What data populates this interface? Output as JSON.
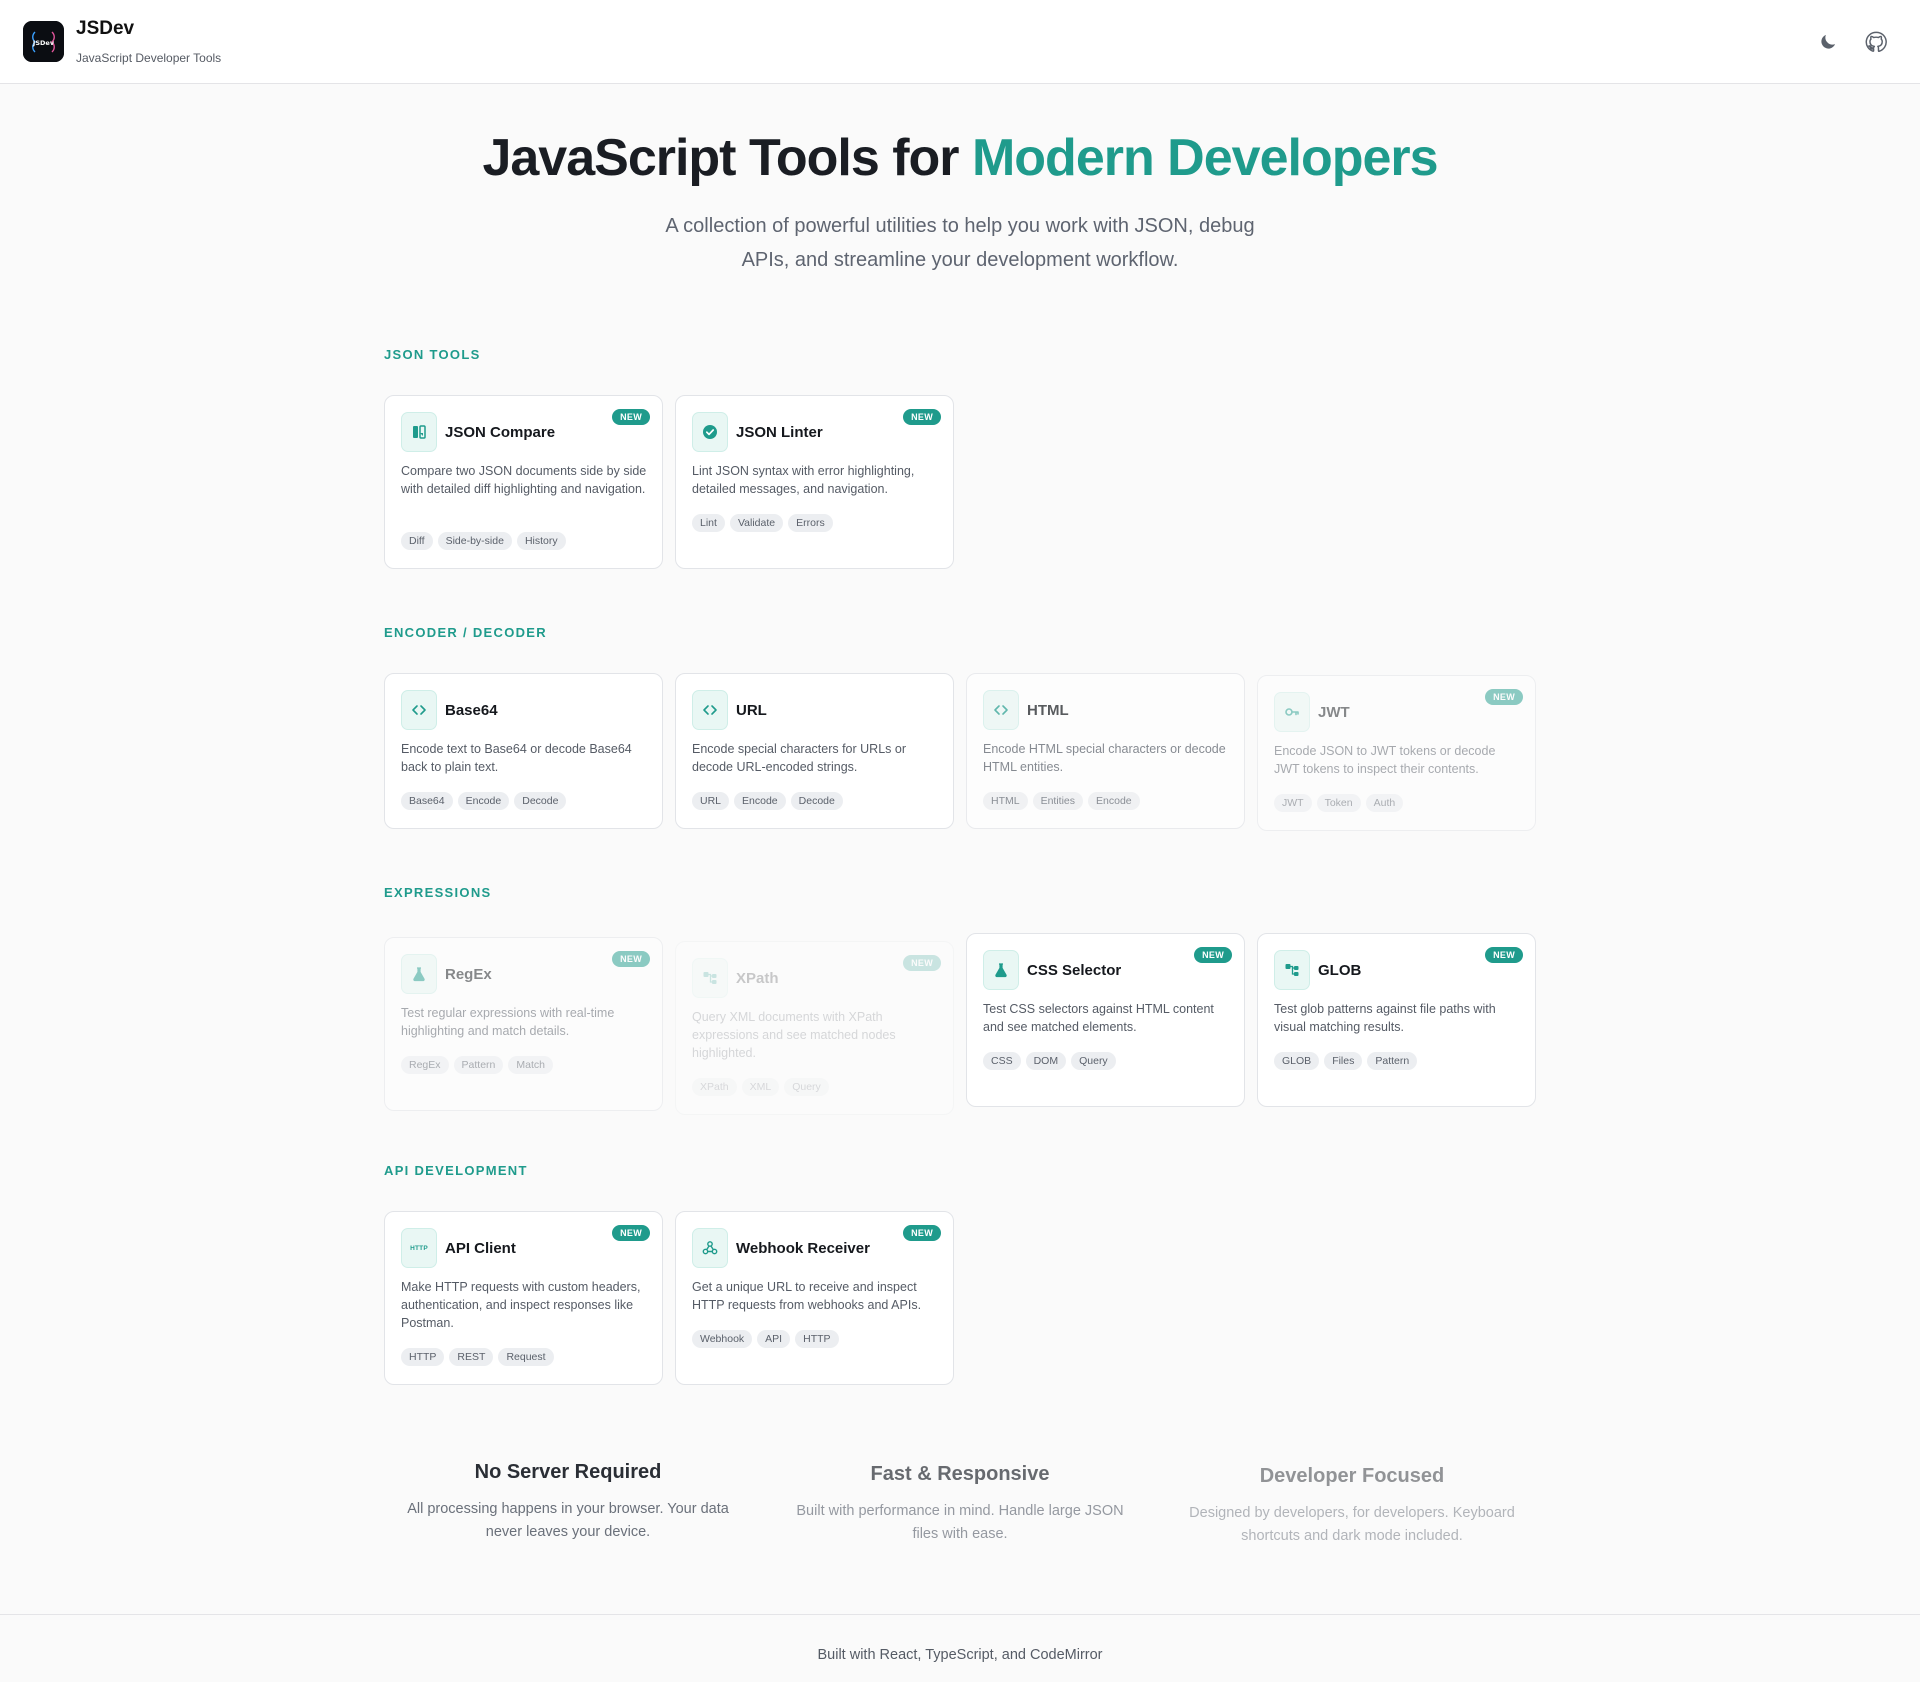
{
  "header": {
    "brand_name": "JSDev",
    "brand_subtitle": "JavaScript Developer Tools",
    "logo_text": "JSDev",
    "theme_toggle_icon": "moon-icon",
    "github_icon": "github-icon"
  },
  "hero": {
    "title_part1": "JavaScript Tools for ",
    "title_accent": "Modern Developers",
    "description": "A collection of powerful utilities to help you work with JSON, debug APIs, and streamline your development workflow."
  },
  "sections": {
    "json_tools": {
      "label": "JSON TOOLS",
      "cards": [
        {
          "title": "JSON Compare",
          "badge": "NEW",
          "icon": "compare-icon",
          "description": "Compare two JSON documents side by side with detailed diff highlighting and navigation.",
          "tags": [
            "Diff",
            "Side-by-side",
            "History"
          ]
        },
        {
          "title": "JSON Linter",
          "badge": "NEW",
          "icon": "check-circle-icon",
          "description": "Lint JSON syntax with error highlighting, detailed messages, and navigation.",
          "tags": [
            "Lint",
            "Validate",
            "Errors"
          ]
        }
      ]
    },
    "encoder_decoder": {
      "label": "ENCODER / DECODER",
      "cards": [
        {
          "title": "Base64",
          "icon": "code-icon",
          "description": "Encode text to Base64 or decode Base64 back to plain text.",
          "tags": [
            "Base64",
            "Encode",
            "Decode"
          ]
        },
        {
          "title": "URL",
          "icon": "code-icon",
          "description": "Encode special characters for URLs or decode URL-encoded strings.",
          "tags": [
            "URL",
            "Encode",
            "Decode"
          ]
        },
        {
          "title": "HTML",
          "icon": "code-icon",
          "description": "Encode HTML special characters or decode HTML entities.",
          "tags": [
            "HTML",
            "Entities",
            "Encode"
          ]
        },
        {
          "title": "JWT",
          "badge": "NEW",
          "icon": "key-icon",
          "description": "Encode JSON to JWT tokens or decode JWT tokens to inspect their contents.",
          "tags": [
            "JWT",
            "Token",
            "Auth"
          ]
        }
      ]
    },
    "expressions": {
      "label": "EXPRESSIONS",
      "cards": [
        {
          "title": "RegEx",
          "badge": "NEW",
          "icon": "flask-icon",
          "description": "Test regular expressions with real-time highlighting and match details.",
          "tags": [
            "RegEx",
            "Pattern",
            "Match"
          ]
        },
        {
          "title": "XPath",
          "badge": "NEW",
          "icon": "tree-icon",
          "description": "Query XML documents with XPath expressions and see matched nodes highlighted.",
          "tags": [
            "XPath",
            "XML",
            "Query"
          ]
        },
        {
          "title": "CSS Selector",
          "badge": "NEW",
          "icon": "flask-icon",
          "description": "Test CSS selectors against HTML content and see matched elements.",
          "tags": [
            "CSS",
            "DOM",
            "Query"
          ]
        },
        {
          "title": "GLOB",
          "badge": "NEW",
          "icon": "tree-icon",
          "description": "Test glob patterns against file paths with visual matching results.",
          "tags": [
            "GLOB",
            "Files",
            "Pattern"
          ]
        }
      ]
    },
    "api_development": {
      "label": "API DEVELOPMENT",
      "cards": [
        {
          "title": "API Client",
          "badge": "NEW",
          "icon": "http-icon",
          "icon_text": "HTTP",
          "description": "Make HTTP requests with custom headers, authentication, and inspect responses like Postman.",
          "tags": [
            "HTTP",
            "REST",
            "Request"
          ]
        },
        {
          "title": "Webhook Receiver",
          "badge": "NEW",
          "icon": "webhook-icon",
          "description": "Get a unique URL to receive and inspect HTTP requests from webhooks and APIs.",
          "tags": [
            "Webhook",
            "API",
            "HTTP"
          ]
        }
      ]
    }
  },
  "features": [
    {
      "title": "No Server Required",
      "description": "All processing happens in your browser. Your data never leaves your device."
    },
    {
      "title": "Fast & Responsive",
      "description": "Built with performance in mind. Handle large JSON files with ease."
    },
    {
      "title": "Developer Focused",
      "description": "Designed by developers, for developers. Keyboard shortcuts and dark mode included."
    }
  ],
  "footer": {
    "text": "Built with React, TypeScript, and CodeMirror"
  },
  "colors": {
    "accent": "#1f9b8c",
    "background": "#fafafa",
    "card_border": "#e2e4e8",
    "icon_bg": "#e9f7f4"
  }
}
